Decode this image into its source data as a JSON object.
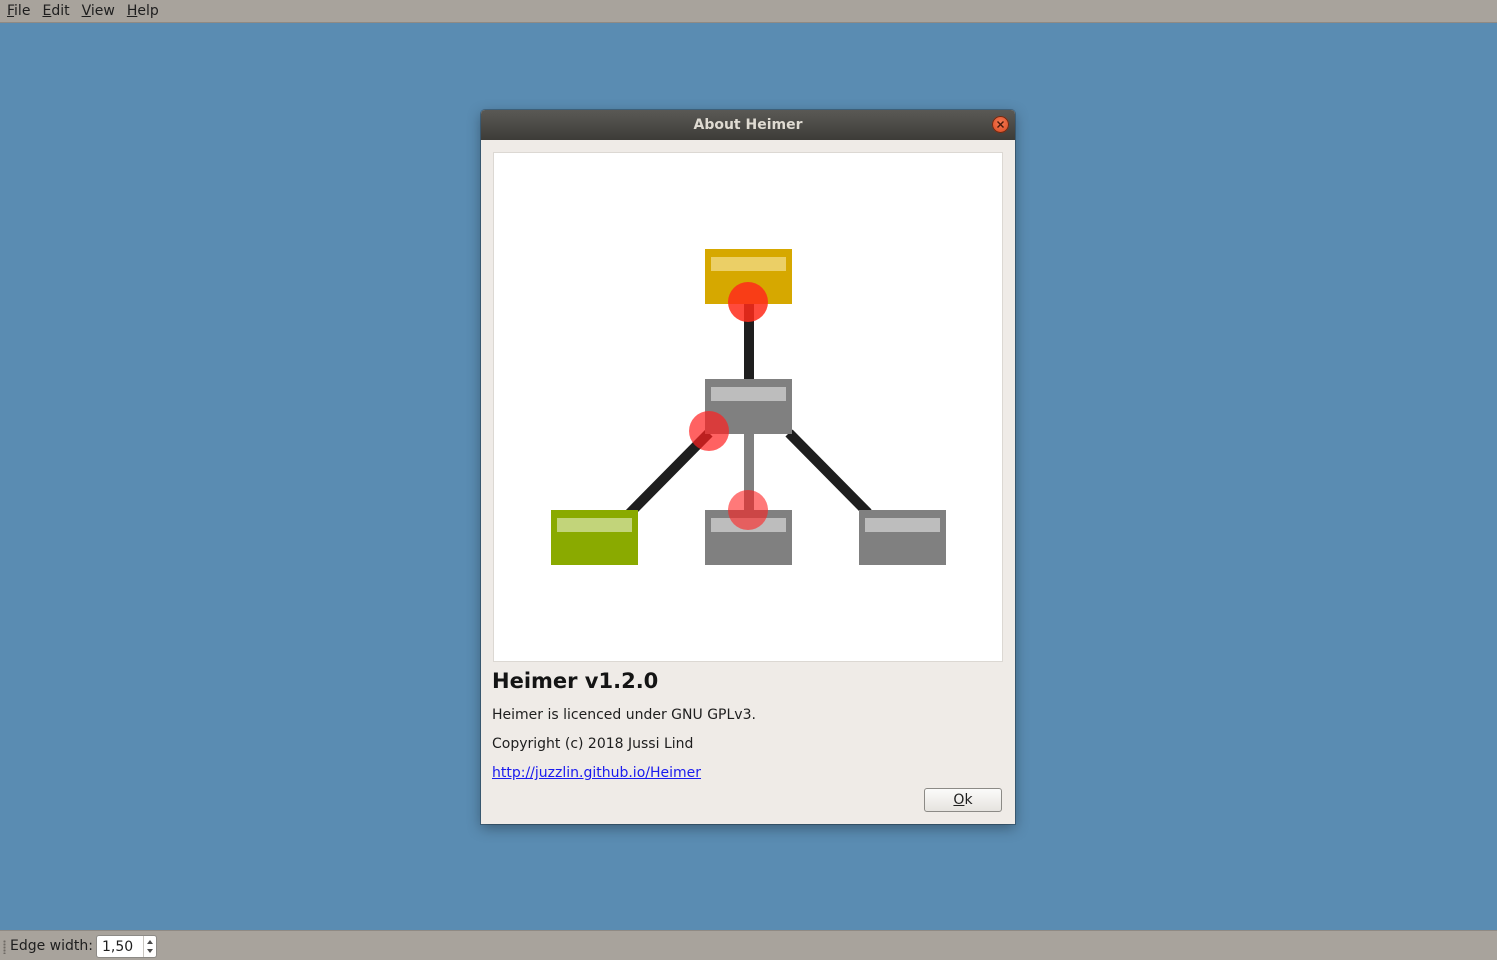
{
  "menubar": {
    "items": [
      {
        "mnemonic": "F",
        "rest": "ile"
      },
      {
        "mnemonic": "E",
        "rest": "dit"
      },
      {
        "mnemonic": "V",
        "rest": "iew"
      },
      {
        "mnemonic": "H",
        "rest": "elp"
      }
    ]
  },
  "dialog": {
    "title": "About Heimer",
    "app_title": "Heimer v1.2.0",
    "license": "Heimer is licenced under GNU GPLv3.",
    "copyright": "Copyright (c) 2018 Jussi Lind",
    "link": "http://juzzlin.github.io/Heimer",
    "ok_mnemonic": "O",
    "ok_rest": "k"
  },
  "statusbar": {
    "edge_width_label": "Edge width:",
    "edge_width_value": "1,50"
  },
  "colors": {
    "canvas_background": "#5a8cb2",
    "node_yellow": "#d6a800",
    "node_green": "#8aaa00",
    "node_gray": "#808080",
    "handle_red": "#ff2020"
  }
}
